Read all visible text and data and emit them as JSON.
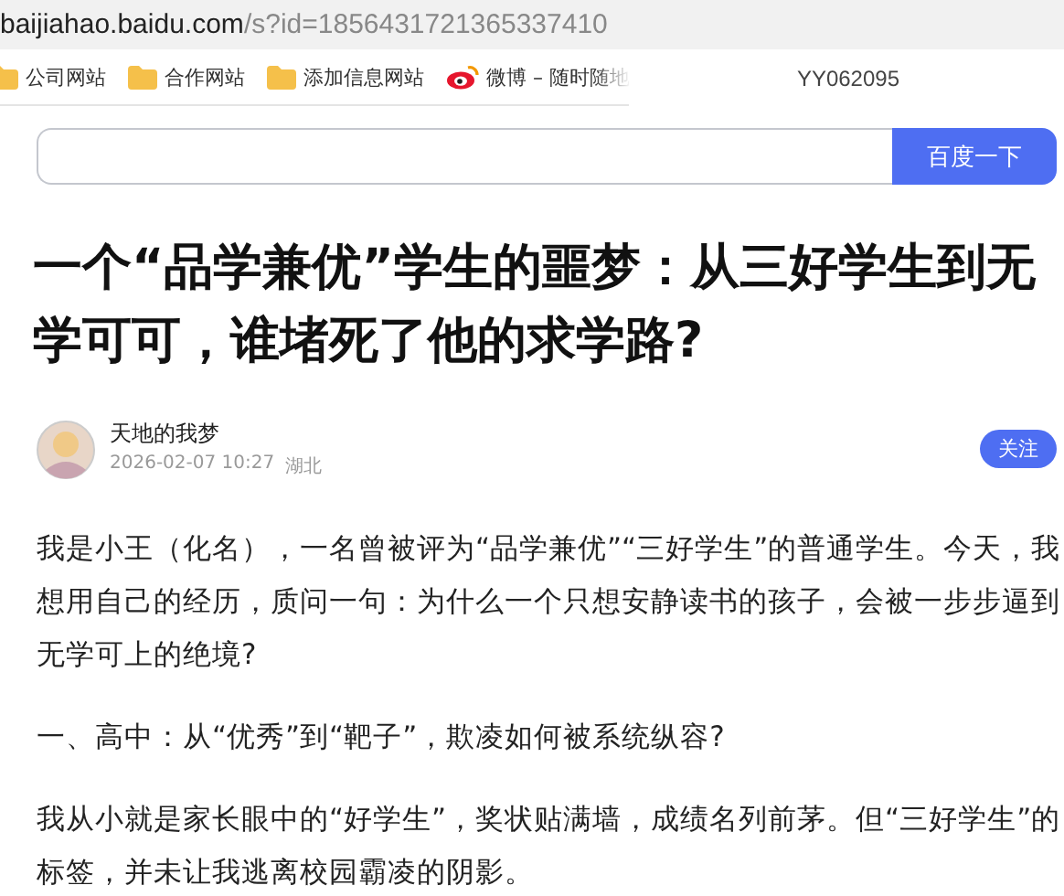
{
  "address_bar": {
    "host": "baijiahao.baidu.com",
    "path": "/s?id=1856431721365337410"
  },
  "bookmarks": [
    {
      "label": "公司网站",
      "kind": "folder"
    },
    {
      "label": "合作网站",
      "kind": "folder"
    },
    {
      "label": "添加信息网站",
      "kind": "folder"
    },
    {
      "label": "微博 – 随时随地",
      "kind": "weibo"
    }
  ],
  "watermark_code": "YY062095",
  "search": {
    "button": "百度一下"
  },
  "article": {
    "title": "一个“品学兼优”学生的噩梦：从三好学生到无学可可，谁堵死了他的求学路?",
    "author": "天地的我梦",
    "date": "2026-02-07 10:27",
    "location": "湖北",
    "follow": "关注",
    "paragraphs": [
      "我是小王（化名），一名曾被评为“品学兼优”“三好学生”的普通学生。今天，我想用自己的经历，质问一句：为什么一个只想安静读书的孩子，会被一步步逼到无学可上的绝境?",
      "一、高中：从“优秀”到“靶子”，欺凌如何被系统纵容?",
      "我从小就是家长眼中的“好学生”，奖状贴满墙，成绩名列前茅。但“三好学生”的标签，并未让我逃离校园霸凌的阴影。"
    ]
  }
}
